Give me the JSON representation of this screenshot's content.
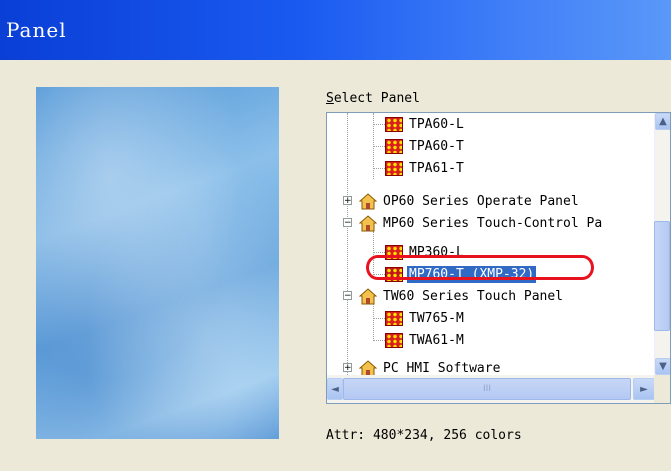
{
  "window": {
    "title": "Panel"
  },
  "select_panel": {
    "label_prefix": "S",
    "label_rest": "elect Panel"
  },
  "tree": {
    "items": [
      {
        "label": "TPA60-L",
        "kind": "panel",
        "level": 2
      },
      {
        "label": "TPA60-T",
        "kind": "panel",
        "level": 2
      },
      {
        "label": "TPA61-T",
        "kind": "panel",
        "level": 2
      },
      {
        "label": "OP60 Series Operate Panel",
        "kind": "folder",
        "level": 1,
        "expander": "+"
      },
      {
        "label": "MP60 Series Touch-Control Pa",
        "kind": "folder",
        "level": 1,
        "expander": "−"
      },
      {
        "label": "MP360-L",
        "kind": "panel",
        "level": 2
      },
      {
        "label": "MP760-T (XMP-32)",
        "kind": "panel",
        "level": 2,
        "selected": true
      },
      {
        "label": "TW60 Series Touch Panel",
        "kind": "folder",
        "level": 1,
        "expander": "−"
      },
      {
        "label": "TW765-M",
        "kind": "panel",
        "level": 2
      },
      {
        "label": "TWA61-M",
        "kind": "panel",
        "level": 2
      },
      {
        "label": "PC HMI Software",
        "kind": "folder",
        "level": 1,
        "expander": "+"
      }
    ],
    "selected_index": 6,
    "highlight_color": "#e8121e"
  },
  "scrollbars": {
    "up": "▲",
    "down": "▼",
    "left": "◄",
    "right": "►",
    "grip": "III"
  },
  "attr": {
    "text": "Attr: 480*234, 256 colors"
  },
  "colors": {
    "titlebar": "#0a3fd6",
    "selection": "#316ac5",
    "background": "#ece9d8"
  }
}
